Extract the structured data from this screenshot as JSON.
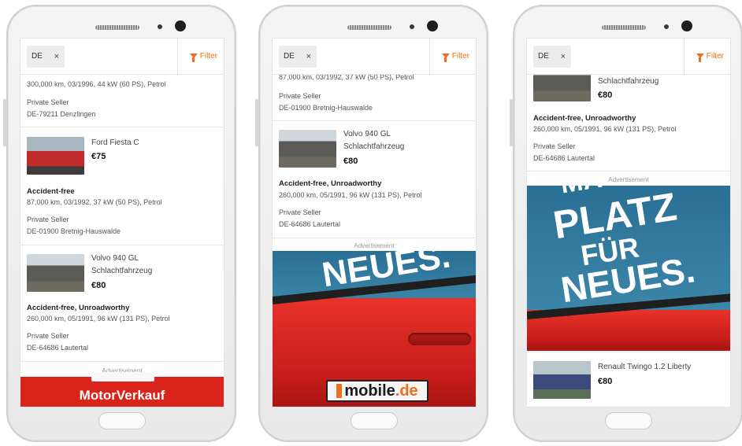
{
  "filter_bar": {
    "chip_label": "DE",
    "chip_close": "×",
    "filter_label": "Filter"
  },
  "ad_label": "Advertisement",
  "listings": {
    "partial_top_1": {
      "details": "300,000 km, 03/1996, 44 kW (60 PS), Petrol",
      "seller": "Private Seller",
      "location": "DE-79211 Denzlingen"
    },
    "fiesta": {
      "title": "Ford Fiesta C",
      "price": "€75",
      "condition": "Accident-free",
      "details": "87,000 km, 03/1992, 37 kW (50 PS), Petrol",
      "seller": "Private Seller",
      "location": "DE-01900 Bretnig-Hauswalde"
    },
    "partial_top_2": {
      "details": "87,000 km, 03/1992, 37 kW (50 PS), Petrol",
      "seller": "Private Seller",
      "location": "DE-01900 Bretnig-Hauswalde"
    },
    "volvo": {
      "title_line1": "Volvo 940 GL",
      "title_line2": "Schlachtfahrzeug",
      "price": "€80",
      "condition": "Accident-free, Unroadworthy",
      "details": "260,000 km, 05/1991, 96 kW (131 PS), Petrol",
      "seller": "Private Seller",
      "location": "DE-64686 Lautertal"
    },
    "twingo": {
      "title": "Renault Twingo 1.2 Liberty",
      "price": "€80"
    }
  },
  "ads": {
    "motor_text": "MotorVerkauf",
    "slogan_1": "MACH",
    "slogan_2": "PLATZ",
    "slogan_3": "FÜR",
    "slogan_4": "NEUES.",
    "brand_name": "mobile",
    "brand_tld": ".de"
  },
  "colors": {
    "accent": "#ef6d1e",
    "ad_red": "#d9231b",
    "sky_blue": "#2a6f95"
  },
  "icons": {
    "filter": "funnel-icon",
    "close": "close-icon"
  }
}
